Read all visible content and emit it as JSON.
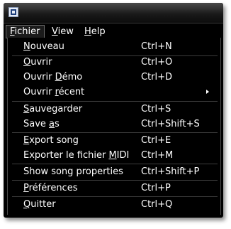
{
  "menubar": {
    "items": [
      {
        "label_pre": "",
        "mnemonic": "F",
        "label_post": "ichier"
      },
      {
        "label_pre": "",
        "mnemonic": "V",
        "label_post": "iew"
      },
      {
        "label_pre": "",
        "mnemonic": "H",
        "label_post": "elp"
      }
    ]
  },
  "fichier_menu": {
    "items": [
      {
        "label_pre": "",
        "mnemonic": "N",
        "label_post": "ouveau",
        "shortcut": "Ctrl+N"
      },
      {
        "label_pre": "",
        "mnemonic": "O",
        "label_post": "uvrir",
        "shortcut": "Ctrl+O"
      },
      {
        "label_pre": "Ouvrir ",
        "mnemonic": "D",
        "label_post": "émo",
        "shortcut": "Ctrl+D"
      },
      {
        "label_pre": "Ouvrir ",
        "mnemonic": "r",
        "label_post": "écent",
        "shortcut": ""
      },
      {
        "label_pre": "",
        "mnemonic": "S",
        "label_post": "auvegarder",
        "shortcut": "Ctrl+S"
      },
      {
        "label_pre": "Save ",
        "mnemonic": "a",
        "label_post": "s",
        "shortcut": "Ctrl+Shift+S"
      },
      {
        "label_pre": "",
        "mnemonic": "E",
        "label_post": "xport song",
        "shortcut": "Ctrl+E"
      },
      {
        "label_pre": "Exporter le fichier ",
        "mnemonic": "M",
        "label_post": "IDI",
        "shortcut": "Ctrl+M"
      },
      {
        "label_pre": "Show song properties",
        "mnemonic": "",
        "label_post": "",
        "shortcut": "Ctrl+Shift+P"
      },
      {
        "label_pre": "",
        "mnemonic": "P",
        "label_post": "références",
        "shortcut": "Ctrl+P"
      },
      {
        "label_pre": "",
        "mnemonic": "Q",
        "label_post": "uitter",
        "shortcut": "Ctrl+Q"
      }
    ]
  },
  "colors": {
    "background": "#000000",
    "text": "#ffffff",
    "separator": "#3c3c3c"
  },
  "icons": {
    "app": "hydrogen-app-icon",
    "submenu": "submenu-arrow-icon"
  }
}
